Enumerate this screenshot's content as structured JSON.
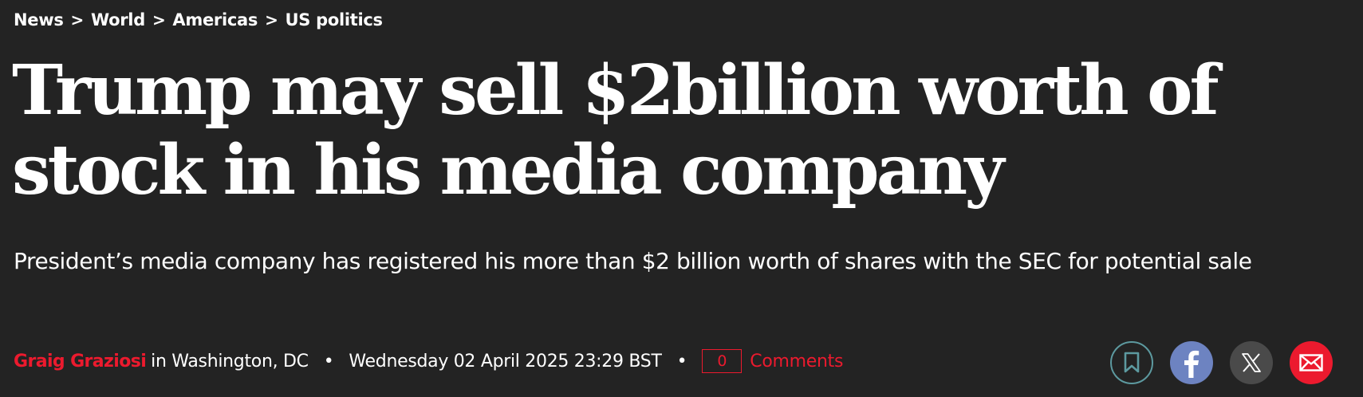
{
  "breadcrumb": {
    "items": [
      {
        "label": "News"
      },
      {
        "label": "World"
      },
      {
        "label": "Americas"
      },
      {
        "label": "US politics"
      }
    ],
    "separator": ">"
  },
  "article": {
    "headline": "Trump may sell $2billion worth of stock in his media company",
    "standfirst": "President’s media company has registered his more than $2 billion worth of shares with the SEC for potential sale"
  },
  "meta": {
    "author": "Graig Graziosi",
    "location": "in Washington, DC",
    "date": "Wednesday 02 April 2025 23:29 BST",
    "dot": "•",
    "comment_count": "0",
    "comments_label": "Comments"
  },
  "share": {
    "icons": [
      "bookmark-icon",
      "facebook-icon",
      "x-icon",
      "email-icon"
    ]
  },
  "colors": {
    "background": "#232323",
    "accent": "#ec1a2e",
    "text": "#ffffff",
    "bookmark_ring": "#5d9aa0",
    "facebook": "#6d83c1",
    "x": "#4a4a4a",
    "email": "#ec1a2e"
  }
}
